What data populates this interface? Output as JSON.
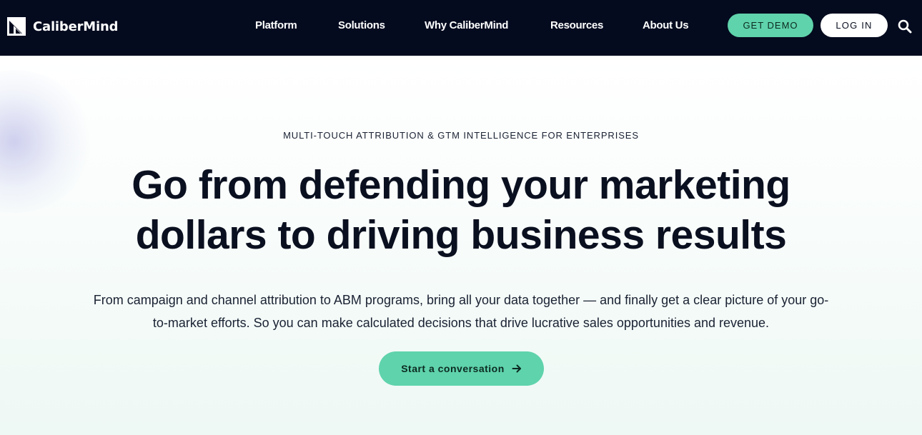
{
  "brand": {
    "name": "CaliberMind",
    "logo_icon": "calibermind-logo-icon"
  },
  "nav": {
    "items": [
      {
        "label": "Platform"
      },
      {
        "label": "Solutions"
      },
      {
        "label": "Why CaliberMind"
      },
      {
        "label": "Resources"
      },
      {
        "label": "About Us"
      }
    ],
    "demo_label": "GET DEMO",
    "login_label": "LOG IN",
    "search_icon": "search-icon"
  },
  "hero": {
    "eyebrow": "MULTI-TOUCH ATTRIBUTION & GTM INTELLIGENCE FOR ENTERPRISES",
    "headline_line1": "Go from defending your marketing",
    "headline_line2": "dollars to driving business results",
    "subtext_line1": "From campaign and channel attribution to ABM programs, bring all your data together — and finally get a clear picture of your go-",
    "subtext_line2": "to-market efforts. So you can make calculated decisions that drive lucrative sales opportunities and revenue.",
    "cta_label": "Start a conversation",
    "cta_icon": "arrow-right-icon"
  },
  "colors": {
    "nav_bg": "#040b1f",
    "accent": "#5fd3ab",
    "text_dark": "#0b1020"
  }
}
